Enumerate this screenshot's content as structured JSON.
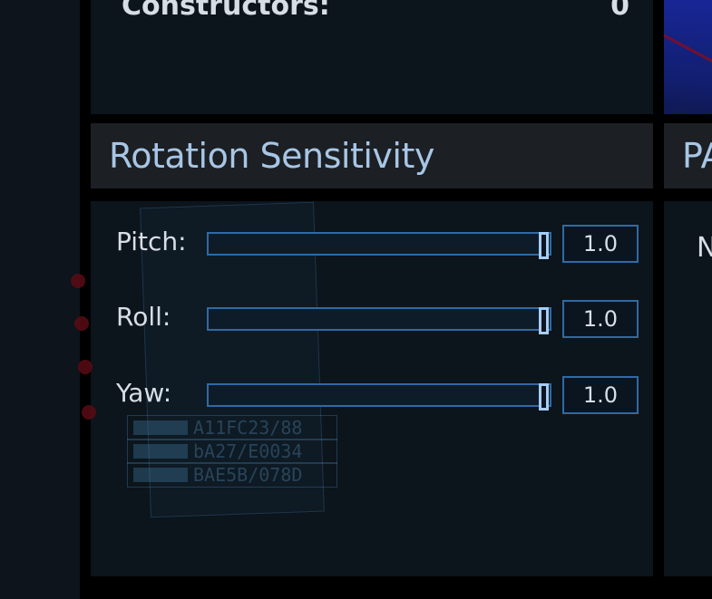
{
  "top_stat": {
    "label": "Constructors:",
    "value": "0"
  },
  "rotation_panel": {
    "title": "Rotation Sensitivity",
    "sliders": [
      {
        "label": "Pitch:",
        "value": "1.0",
        "level": 1.0
      },
      {
        "label": "Roll:",
        "value": "1.0",
        "level": 1.0
      },
      {
        "label": "Yaw:",
        "value": "1.0",
        "level": 1.0
      }
    ]
  },
  "side_panel": {
    "title_fragment": "PA",
    "text_fragment": "N"
  },
  "background_codes": [
    "A11FC23/88",
    "bA27/E0034",
    "BAE5B/078D"
  ],
  "colors": {
    "background": "#0b0f15",
    "panel": "#0c141c",
    "header": "#1c1f23",
    "title": "#a7c6e6",
    "accent": "#2f6aa3",
    "handle": "#a7cdf4"
  }
}
